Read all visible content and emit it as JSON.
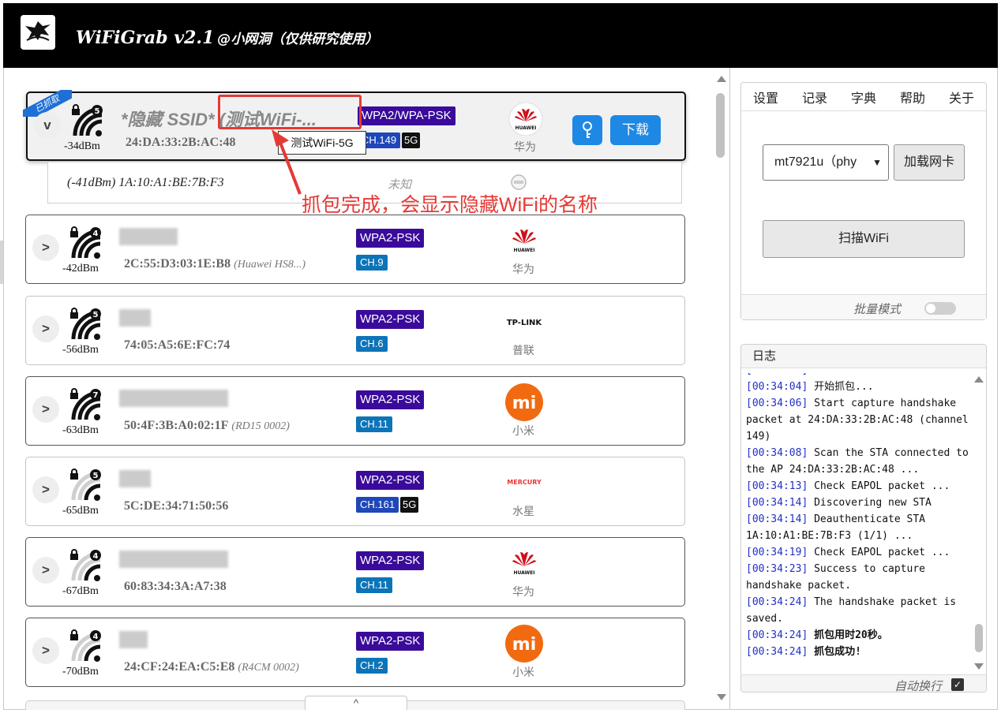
{
  "app": {
    "title": "WiFiGrab v2.1",
    "subtitle": "@小网洞（仅供研究使用）"
  },
  "annotation": {
    "text": "抓包完成，会显示隐藏WiFi的名称",
    "tooltip": "测试WiFi-5G"
  },
  "connected": {
    "tag": "已抓取",
    "expand": "v",
    "signal_count": "5",
    "dbm": "-34dBm",
    "ssid": "*隐藏 SSID* (测试WiFi-...",
    "mac": "24:DA:33:2B:AC:48",
    "encryption": "WPA2/WPA-PSK",
    "channel": "CH.149",
    "band": "5G",
    "vendor": "华为",
    "vendor_logo": "huawei-logo",
    "download_label": "下载",
    "client": {
      "info": "(-41dBm) 1A:10:A1:BE:7B:F3",
      "vendor": "未知"
    }
  },
  "networks": [
    {
      "expand": ">",
      "signal_count": "4",
      "dbm": "-42dBm",
      "mac": "2C:55:D3:03:1E:B8",
      "model": "(Huawei HS8...)",
      "encryption": "WPA2-PSK",
      "channel": "CH.9",
      "band": "",
      "vendor": "华为",
      "vendor_logo": "huawei-logo"
    },
    {
      "expand": ">",
      "signal_count": "5",
      "dbm": "-56dBm",
      "mac": "74:05:A5:6E:FC:74",
      "model": "",
      "encryption": "WPA2-PSK",
      "channel": "CH.6",
      "band": "",
      "vendor": "普联",
      "vendor_logo": "tplink-logo",
      "logo_text": "TP-LINK"
    },
    {
      "expand": ">",
      "signal_count": "7",
      "dbm": "-63dBm",
      "mac": "50:4F:3B:A0:02:1F",
      "model": "(RD15 0002)",
      "encryption": "WPA2-PSK",
      "channel": "CH.11",
      "band": "",
      "vendor": "小米",
      "vendor_logo": "xiaomi-logo",
      "logo_text": "mi"
    },
    {
      "expand": ">",
      "signal_count": "5",
      "dbm": "-65dBm",
      "mac": "5C:DE:34:71:50:56",
      "model": "",
      "encryption": "WPA2-PSK",
      "channel": "CH.161",
      "band": "5G",
      "vendor": "水星",
      "vendor_logo": "mercury-logo",
      "logo_text": "MERCURY"
    },
    {
      "expand": ">",
      "signal_count": "4",
      "dbm": "-67dBm",
      "mac": "60:83:34:3A:A7:38",
      "model": "",
      "encryption": "WPA2-PSK",
      "channel": "CH.11",
      "band": "",
      "vendor": "华为",
      "vendor_logo": "huawei-logo"
    },
    {
      "expand": ">",
      "signal_count": "4",
      "dbm": "-70dBm",
      "mac": "24:CF:24:EA:C5:E8",
      "model": "(R4CM 0002)",
      "encryption": "WPA2-PSK",
      "channel": "CH.2",
      "band": "",
      "vendor": "小米",
      "vendor_logo": "xiaomi-logo",
      "logo_text": "mi"
    }
  ],
  "list_bottom_tab": "^",
  "menu": [
    "设置",
    "记录",
    "字典",
    "帮助",
    "关于"
  ],
  "adapter": {
    "selected": "mt7921u（phy",
    "load_label": "加载网卡",
    "scan_label": "扫描WiFi",
    "batch_label": "批量模式"
  },
  "log": {
    "title": "日志",
    "wrap_label": "自动换行",
    "check": "✓",
    "lines": [
      {
        "ts": "[00:34:04]",
        "text": " ---------------------",
        "bold": false
      },
      {
        "ts": "[00:34:04]",
        "text": " 开始抓包...",
        "bold": false
      },
      {
        "ts": "[00:34:06]",
        "text": " Start capture handshake packet at 24:DA:33:2B:AC:48 (channel 149)",
        "bold": false
      },
      {
        "ts": "[00:34:08]",
        "text": " Scan the STA connected to the AP 24:DA:33:2B:AC:48 ...",
        "bold": false
      },
      {
        "ts": "[00:34:13]",
        "text": " Check EAPOL packet ...",
        "bold": false
      },
      {
        "ts": "[00:34:14]",
        "text": " Discovering new STA",
        "bold": false
      },
      {
        "ts": "[00:34:14]",
        "text": " Deauthenticate STA 1A:10:A1:BE:7B:F3 (1/1) ...",
        "bold": false
      },
      {
        "ts": "[00:34:19]",
        "text": " Check EAPOL packet ...",
        "bold": false
      },
      {
        "ts": "[00:34:23]",
        "text": " Success to capture handshake packet.",
        "bold": false
      },
      {
        "ts": "[00:34:24]",
        "text": " The handshake packet is saved.",
        "bold": false
      },
      {
        "ts": "[00:34:24]",
        "text": " 抓包用时20秒。",
        "bold": true
      },
      {
        "ts": "[00:34:24]",
        "text": " 抓包成功!",
        "bold": true
      }
    ]
  },
  "colors": {
    "accent": "#1e88e5",
    "annotation": "#e53935",
    "encryption": "#3a0b9a",
    "timestamp": "#2030c8"
  }
}
